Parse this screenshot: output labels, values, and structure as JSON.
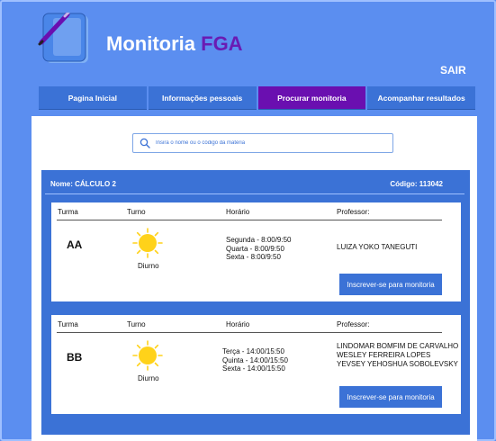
{
  "app": {
    "brand_main": "Monitoria",
    "brand_accent": "FGA",
    "logout_label": "SAIR"
  },
  "nav": {
    "tabs": [
      {
        "label": "Pagina Inicial",
        "active": false
      },
      {
        "label": "Informações pessoais",
        "active": false
      },
      {
        "label": "Procurar monitoria",
        "active": true
      },
      {
        "label": "Acompanhar resultados",
        "active": false
      }
    ]
  },
  "search": {
    "placeholder": "Insira o nome ou o código da matéria"
  },
  "course": {
    "name_label": "Nome: CÁLCULO 2",
    "code_label": "Código: 113042"
  },
  "columns": {
    "turma": "Turma",
    "turno": "Turno",
    "horario": "Horário",
    "professor": "Professor:"
  },
  "classes": [
    {
      "turma": "AA",
      "turno": "Diurno",
      "icon": "sun-icon",
      "horario": [
        "Segunda - 8:00/9:50",
        "Quarta - 8:00/9:50",
        "Sexta - 8:00/9:50"
      ],
      "professores": [
        "LUIZA YOKO TANEGUTI"
      ],
      "button_label": "Inscrever-se para monitoria"
    },
    {
      "turma": "BB",
      "turno": "Diurno",
      "icon": "sun-icon",
      "horario": [
        "Terça - 14:00/15:50",
        "Quinta - 14:00/15:50",
        "Sexta - 14:00/15:50"
      ],
      "professores": [
        "LINDOMAR BOMFIM DE CARVALHO",
        "WESLEY FERREIRA LOPES",
        "YEVSEY YEHOSHUA SOBOLEVSKY"
      ],
      "button_label": "Inscrever-se para monitoria"
    }
  ],
  "colors": {
    "background": "#5b8ef0",
    "primary": "#3b72d6",
    "accent": "#6a0fb0",
    "sun": "#ffd21a"
  }
}
